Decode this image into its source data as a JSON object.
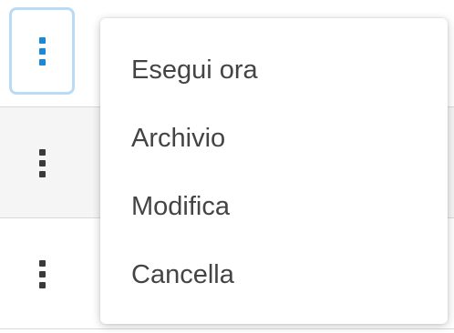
{
  "menu": {
    "items": [
      {
        "label": "Esegui ora"
      },
      {
        "label": "Archivio"
      },
      {
        "label": "Modifica"
      },
      {
        "label": "Cancella"
      }
    ]
  },
  "icons": {
    "active_trigger": "kebab-vertical-icon",
    "row_trigger": "kebab-vertical-icon"
  },
  "colors": {
    "accent": "#1a88d6",
    "focus_ring": "#b9dbf6",
    "text": "#444444",
    "icon_dark": "#3a3a3a",
    "row_alt": "#f5f5f5",
    "divider": "#d9d9d9"
  }
}
